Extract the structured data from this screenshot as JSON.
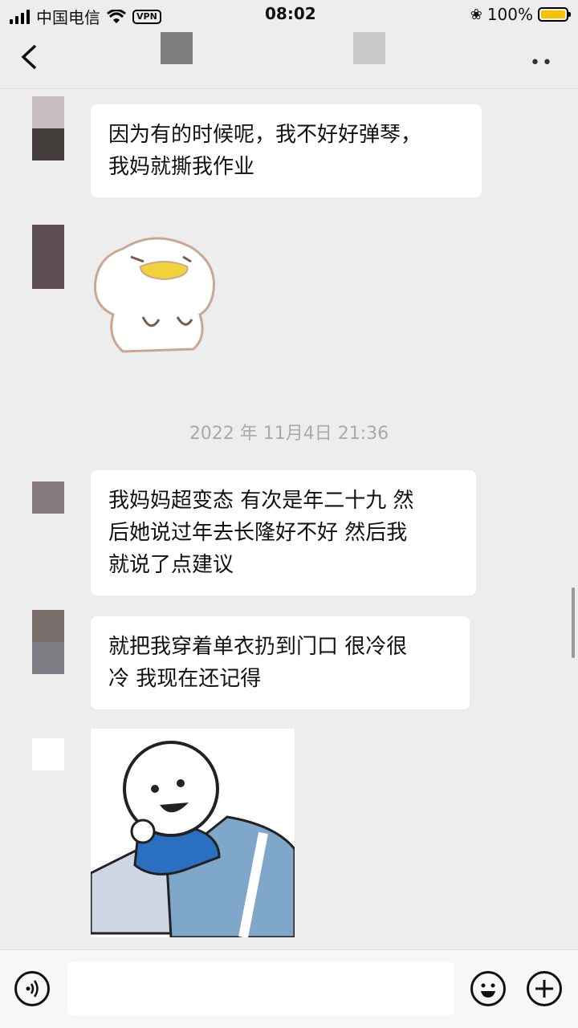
{
  "status": {
    "carrier": "中国电信",
    "vpn": "VPN",
    "time": "08:02",
    "battery": "100%",
    "battery_color": "#f5c400"
  },
  "header": {
    "back_icon": "chevron-left-icon",
    "more": "••"
  },
  "messages": [
    {
      "type": "text",
      "text_lines": [
        "因为有的时候呢，我不好好弹琴，",
        "我妈就撕我作业"
      ]
    },
    {
      "type": "sticker",
      "sticker": "white-duck-sticker"
    },
    {
      "type": "timestamp",
      "text": "2022 年 11月4日 21:36"
    },
    {
      "type": "text",
      "text_lines": [
        "我妈妈超变态 有次是年二十九 然",
        "后她说过年去长隆好不好 然后我",
        "就说了点建议"
      ]
    },
    {
      "type": "text",
      "text_lines": [
        "就把我穿着单衣扔到门口 很冷很",
        "冷 我现在还记得"
      ]
    },
    {
      "type": "sticker",
      "sticker": "smiling-person-in-bed-sticker"
    }
  ],
  "inputbar": {
    "voice_icon": "voice-icon",
    "emoji_icon": "emoji-icon",
    "plus_icon": "plus-icon",
    "value": ""
  }
}
